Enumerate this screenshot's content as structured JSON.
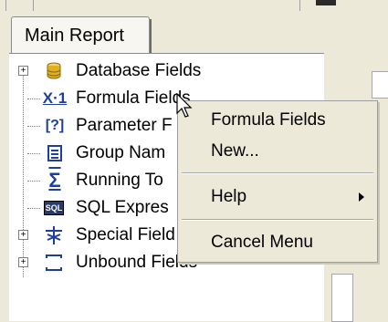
{
  "tab": {
    "label": "Main Report"
  },
  "tree": {
    "items": [
      {
        "label": "Database Fields",
        "icon": "database-icon",
        "expandable": true
      },
      {
        "label": "Formula Fields",
        "icon": "formula-icon",
        "expandable": false
      },
      {
        "label": "Parameter F",
        "icon": "parameter-icon",
        "expandable": false
      },
      {
        "label": "Group Nam",
        "icon": "group-icon",
        "expandable": false
      },
      {
        "label": "Running To",
        "icon": "sigma-icon",
        "expandable": false
      },
      {
        "label": "SQL Expres",
        "icon": "sql-icon",
        "expandable": false
      },
      {
        "label": "Special Field",
        "icon": "special-icon",
        "expandable": true
      },
      {
        "label": "Unbound Fields",
        "icon": "unbound-icon",
        "expandable": true
      }
    ],
    "formula_icon_text": "X·1",
    "parameter_icon_text": "[?]",
    "sql_icon_text": "SQL"
  },
  "context_menu": {
    "items": [
      {
        "label": "Formula Fields"
      },
      {
        "label": "New..."
      },
      {
        "label": "Help",
        "submenu": true
      },
      {
        "label": "Cancel Menu"
      }
    ]
  },
  "colors": {
    "face": "#ece9d8",
    "database": "#e0b020",
    "icon_blue": "#1f3fa0"
  }
}
